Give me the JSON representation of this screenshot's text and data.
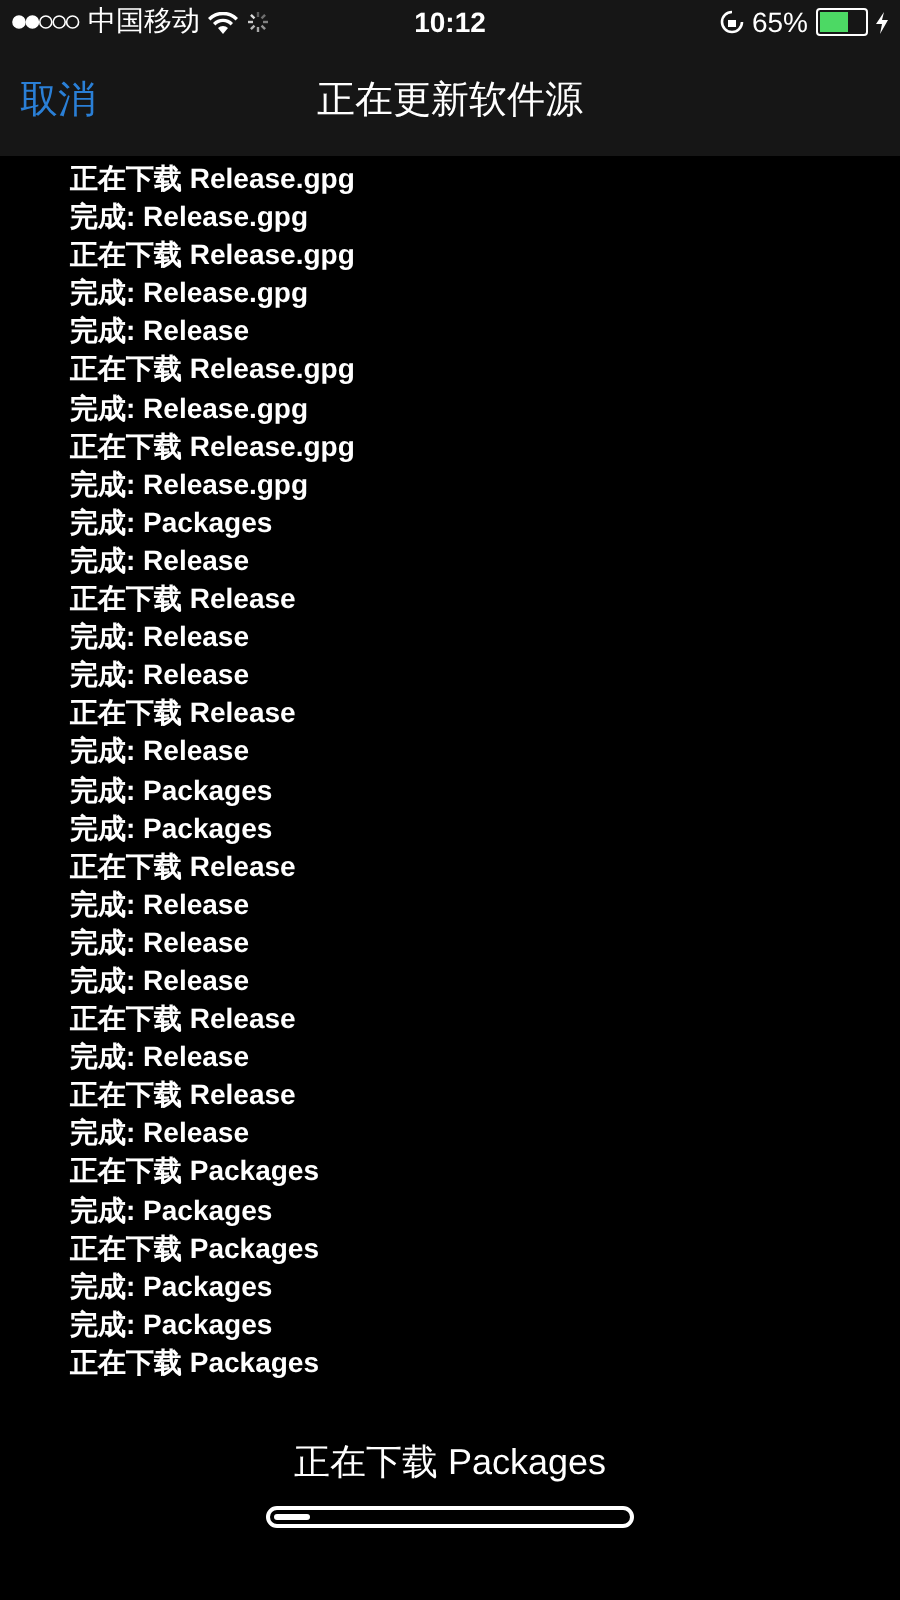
{
  "status_bar": {
    "carrier": "中国移动",
    "time": "10:12",
    "battery": "65%"
  },
  "nav_bar": {
    "cancel": "取消",
    "title": "正在更新软件源"
  },
  "log": [
    "正在下载 Release.gpg",
    "完成: Release.gpg",
    "正在下载 Release.gpg",
    "完成: Release.gpg",
    "完成: Release",
    "正在下载 Release.gpg",
    "完成: Release.gpg",
    "正在下载 Release.gpg",
    "完成: Release.gpg",
    "完成: Packages",
    "完成: Release",
    "正在下载 Release",
    "完成: Release",
    "完成: Release",
    "正在下载 Release",
    "完成: Release",
    "完成: Packages",
    "完成: Packages",
    "正在下载 Release",
    "完成: Release",
    "完成: Release",
    "完成: Release",
    "正在下载 Release",
    "完成: Release",
    "正在下载 Release",
    "完成: Release",
    "正在下载 Packages",
    "完成: Packages",
    "正在下载 Packages",
    "完成: Packages",
    "完成: Packages",
    "正在下载 Packages"
  ],
  "progress": {
    "label": "正在下载 Packages",
    "level": 0.1
  }
}
